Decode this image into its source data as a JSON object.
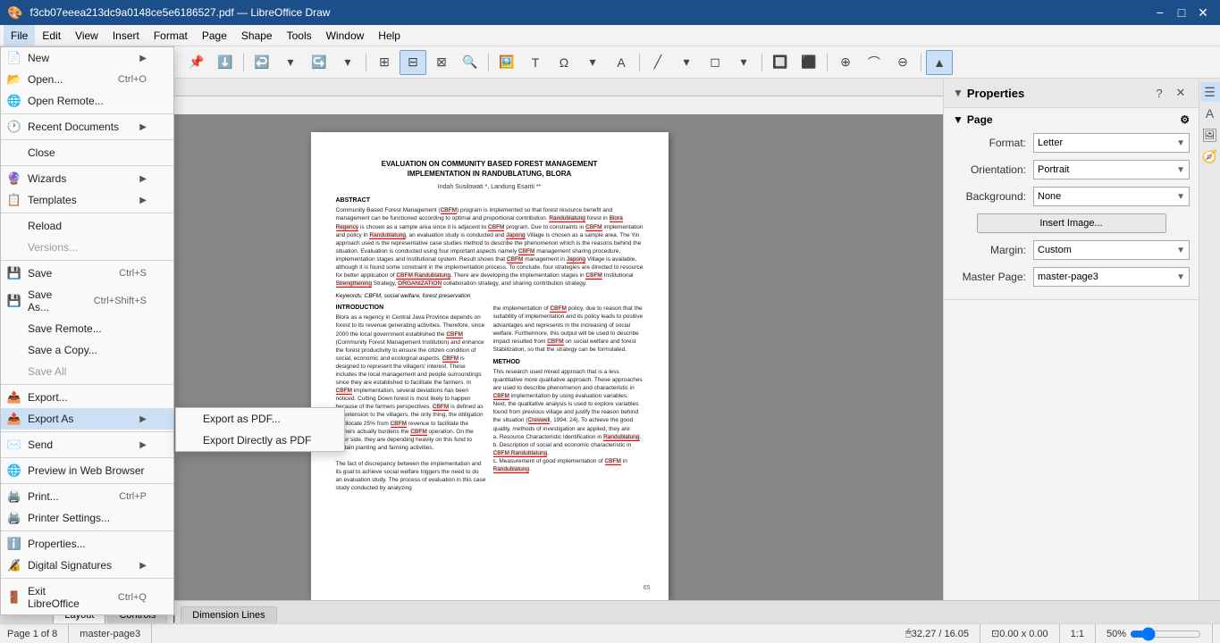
{
  "titlebar": {
    "title": "f3cb07eeea213dc9a0148ce5e6186527.pdf — LibreOffice Draw",
    "minimize": "−",
    "maximize": "□",
    "close": "✕"
  },
  "menubar": {
    "items": [
      "File",
      "Edit",
      "View",
      "Insert",
      "Format",
      "Page",
      "Shape",
      "Tools",
      "Window",
      "Help"
    ]
  },
  "file_menu": {
    "items": [
      {
        "label": "New",
        "shortcut": "",
        "hasArrow": true,
        "icon": "📄",
        "key": "new"
      },
      {
        "label": "Open...",
        "shortcut": "Ctrl+O",
        "hasArrow": false,
        "icon": "📂",
        "key": "open"
      },
      {
        "label": "Open Remote...",
        "shortcut": "",
        "hasArrow": false,
        "icon": "🌐",
        "key": "open-remote"
      },
      {
        "separator": true
      },
      {
        "label": "Recent Documents",
        "shortcut": "",
        "hasArrow": true,
        "icon": "🕐",
        "key": "recent"
      },
      {
        "separator": true
      },
      {
        "label": "Close",
        "shortcut": "",
        "hasArrow": false,
        "icon": "✕",
        "key": "close"
      },
      {
        "separator": true
      },
      {
        "label": "Wizards",
        "shortcut": "",
        "hasArrow": true,
        "icon": "🔮",
        "key": "wizards"
      },
      {
        "label": "Templates",
        "shortcut": "",
        "hasArrow": true,
        "icon": "📋",
        "key": "templates"
      },
      {
        "separator": true
      },
      {
        "label": "Reload",
        "shortcut": "",
        "hasArrow": false,
        "icon": "",
        "key": "reload"
      },
      {
        "label": "Versions...",
        "shortcut": "",
        "hasArrow": false,
        "icon": "",
        "key": "versions",
        "disabled": true
      },
      {
        "separator": true
      },
      {
        "label": "Save",
        "shortcut": "Ctrl+S",
        "hasArrow": false,
        "icon": "💾",
        "key": "save"
      },
      {
        "label": "Save As...",
        "shortcut": "Ctrl+Shift+S",
        "hasArrow": false,
        "icon": "💾",
        "key": "save-as"
      },
      {
        "label": "Save Remote...",
        "shortcut": "",
        "hasArrow": false,
        "icon": "",
        "key": "save-remote"
      },
      {
        "label": "Save a Copy...",
        "shortcut": "",
        "hasArrow": false,
        "icon": "",
        "key": "save-copy"
      },
      {
        "label": "Save All",
        "shortcut": "",
        "hasArrow": false,
        "icon": "",
        "key": "save-all",
        "disabled": true
      },
      {
        "separator": true
      },
      {
        "label": "Export...",
        "shortcut": "",
        "hasArrow": false,
        "icon": "📤",
        "key": "export"
      },
      {
        "label": "Export As",
        "shortcut": "",
        "hasArrow": true,
        "icon": "📤",
        "key": "export-as",
        "highlighted": true
      },
      {
        "separator": true
      },
      {
        "label": "Send",
        "shortcut": "",
        "hasArrow": true,
        "icon": "✉️",
        "key": "send"
      },
      {
        "separator": true
      },
      {
        "label": "Preview in Web Browser",
        "shortcut": "",
        "hasArrow": false,
        "icon": "🌐",
        "key": "preview-web"
      },
      {
        "separator": true
      },
      {
        "label": "Print...",
        "shortcut": "Ctrl+P",
        "hasArrow": false,
        "icon": "🖨️",
        "key": "print"
      },
      {
        "label": "Printer Settings...",
        "shortcut": "",
        "hasArrow": false,
        "icon": "🖨️",
        "key": "printer-settings"
      },
      {
        "separator": true
      },
      {
        "label": "Properties...",
        "shortcut": "",
        "hasArrow": false,
        "icon": "ℹ️",
        "key": "properties"
      },
      {
        "label": "Digital Signatures",
        "shortcut": "",
        "hasArrow": true,
        "icon": "🔏",
        "key": "digital-signatures"
      },
      {
        "separator": true
      },
      {
        "label": "Exit LibreOffice",
        "shortcut": "Ctrl+Q",
        "hasArrow": false,
        "icon": "🚪",
        "key": "exit"
      }
    ]
  },
  "export_as_submenu": {
    "items": [
      {
        "label": "Export as PDF...",
        "key": "export-pdf"
      },
      {
        "label": "Export Directly as PDF",
        "key": "export-direct-pdf"
      }
    ]
  },
  "properties_panel": {
    "title": "Properties",
    "page_section": "Page",
    "format_label": "Format:",
    "format_value": "Letter",
    "orientation_label": "Orientation:",
    "orientation_value": "Portrait",
    "background_label": "Background:",
    "background_value": "None",
    "insert_image_label": "Insert Image...",
    "margin_label": "Margin:",
    "margin_value": "Custom",
    "master_page_label": "Master Page:",
    "master_page_value": "master-page3"
  },
  "document": {
    "title": "EVALUATION ON COMMUNITY BASED FOREST MANAGEMENT\nIMPLEMENTATION IN RANDUBLATUNG, BLORA",
    "authors": "Indah Susilowati *, Landung Esariti **",
    "abstract_heading": "ABSTRACT",
    "abstract_text": "Community Based Forest Management (CBFM) program is implemented so that forest resource benefit and management can be functioned according to optimal and proportional contribution. Randublatung forest in Blora Regency is chosen as a sample area since it is adjacent to CBFM program. Due to constraints in CBFM implementation and policy in Randublatung, an evaluation study is conducted and Japong Village is chosen as a sample area. The Yin approach used is the representative case studies method to describe the phenomenon which is the reasons behind the situation. Evaluation is conducted using four important aspects namely CBFM management sharing procedure, implementation stages and Institutional system. Result shows that CBFM management in Japong Village is available, although it is found some constraint in the implementation process. To conclude, four strategies are directed to resource for better application of CBFM Randublatung. There are developing the implementation stages in CBFM Institutional Strengthening Strategy, ORGANIZATION collaboration strategy, and sharing contribution strategy.",
    "keywords": "Keywords: CBFM, social welfare, forest preservation",
    "intro_heading": "INTRODUCTION",
    "intro_text": "Blora as a regency in Central Java Province depends on forest to its revenue generating activities. Therefore, since 2000 the local government established the CBFM (Community Forest Management Institution) and enhance the forest productivity to ensure the citizen condition of social, economic and ecological aspects. CBFM is designed to represent the villagers' interest. These includes the local management and people surroundings since they are established to facilitate the farmers. In CBFM implementation, several deviations has been noticed. Cutting Down forest is most likely to happen because of the farmers perspectives. CBFM is defined as an extension to the villagers, the only thing, the obligation to allocate 25% from CBFM revenue to facilitate the farmers actually burdens the CBFM operation. On the other side, they are depending heavily on this fund to sustain planting and farming activities.",
    "page_number": "65"
  },
  "statusbar": {
    "page_info": "Page 1 of 8",
    "master_page": "master-page3",
    "position": "32.27 / 16.05",
    "dimensions": "0.00 x 0.00",
    "zoom_ratio": "1:1",
    "zoom_percent": "50%"
  },
  "tabs": [
    {
      "label": "Layout",
      "active": true
    },
    {
      "label": "Controls",
      "active": false
    },
    {
      "label": "Dimension Lines",
      "active": false
    }
  ]
}
